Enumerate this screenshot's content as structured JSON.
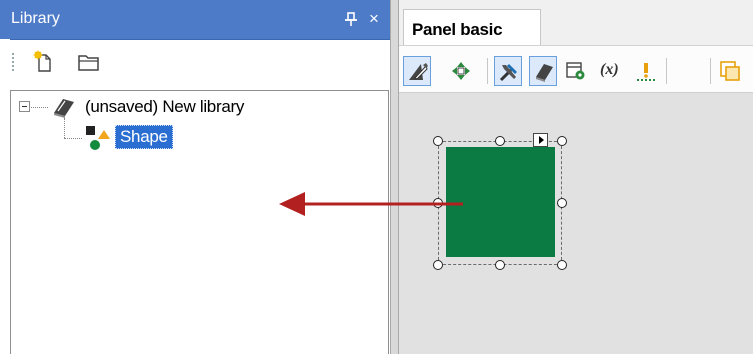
{
  "library_pane": {
    "title": "Library",
    "pin_icon": "pin-icon",
    "close_icon": "close-icon",
    "close_glyph": "×",
    "toolbar": {
      "new_library_icon": "new-library-icon",
      "open_library_icon": "open-folder-icon"
    },
    "tree": {
      "root": {
        "label": "(unsaved) New library",
        "icon": "book-icon",
        "expanded": true
      },
      "children": [
        {
          "label": "Shape",
          "icon": "shapes-icon",
          "selected": true
        }
      ]
    }
  },
  "panel_editor": {
    "tabs": [
      {
        "label": "Panel basic",
        "active": true
      }
    ],
    "toolbar": {
      "items": [
        {
          "icon": "draw-tool-icon",
          "active": true
        },
        {
          "icon": "move-icon",
          "active": false
        },
        {
          "icon": "tools-icon",
          "active": true
        },
        {
          "icon": "library-book-icon",
          "active": true
        },
        {
          "icon": "form-settings-icon",
          "active": false
        },
        {
          "icon": "variable-icon",
          "label": "(x)",
          "active": false
        },
        {
          "icon": "anchor-icon",
          "active": false
        },
        {
          "icon": "bring-front-icon",
          "active": false
        }
      ]
    },
    "canvas": {
      "shape": {
        "type": "rectangle",
        "fill": "#0b7a43",
        "selected": true
      }
    }
  },
  "drag_arrow": {
    "color": "#b32020",
    "direction": "left"
  },
  "colors": {
    "titlebar": "#4e7bc7",
    "selection": "#2a6ed2",
    "canvas": "#e1e1e1"
  }
}
